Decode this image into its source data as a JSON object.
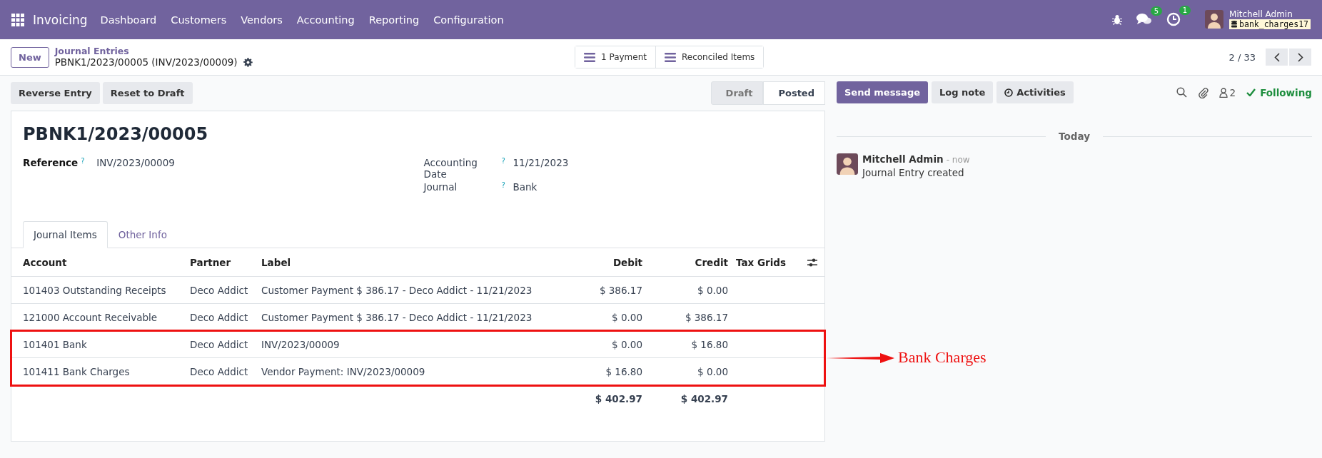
{
  "navbar": {
    "app": "Invoicing",
    "menu": [
      "Dashboard",
      "Customers",
      "Vendors",
      "Accounting",
      "Reporting",
      "Configuration"
    ],
    "messages_badge": "5",
    "activities_badge": "1",
    "user": "Mitchell Admin",
    "database": "bank_charges17"
  },
  "breadcrumb": {
    "new_button": "New",
    "parent": "Journal Entries",
    "current": "PBNK1/2023/00005 (INV/2023/00009)"
  },
  "smart_buttons": [
    "1 Payment",
    "Reconciled Items"
  ],
  "pager": {
    "value": "2 / 33"
  },
  "actions": [
    "Reverse Entry",
    "Reset to Draft"
  ],
  "statuses": [
    {
      "label": "Draft",
      "selected": false
    },
    {
      "label": "Posted",
      "selected": true
    }
  ],
  "form": {
    "title": "PBNK1/2023/00005",
    "fields_left": [
      {
        "label": "Reference",
        "help": "?",
        "value": "INV/2023/00009"
      }
    ],
    "fields_right": [
      {
        "label": "Accounting Date",
        "help": "?",
        "value": "11/21/2023"
      },
      {
        "label": "Journal",
        "help": "?",
        "value": "Bank"
      }
    ],
    "tabs": [
      {
        "label": "Journal Items",
        "selected": true
      },
      {
        "label": "Other Info",
        "selected": false
      }
    ],
    "table": {
      "columns": [
        {
          "label": "Account",
          "kind": "text"
        },
        {
          "label": "Partner",
          "kind": "text"
        },
        {
          "label": "Label",
          "kind": "text"
        },
        {
          "label": "Debit",
          "kind": "amount"
        },
        {
          "label": "Credit",
          "kind": "amount"
        },
        {
          "label": "Tax Grids",
          "kind": "text"
        }
      ],
      "rows": [
        {
          "cells": [
            "101403 Outstanding Receipts",
            "Deco Addict",
            "Customer Payment $ 386.17 - Deco Addict - 11/21/2023",
            "$ 386.17",
            "$ 0.00"
          ],
          "in_callout": false
        },
        {
          "cells": [
            "121000 Account Receivable",
            "Deco Addict",
            "Customer Payment $ 386.17 - Deco Addict - 11/21/2023",
            "$ 0.00",
            "$ 386.17"
          ],
          "in_callout": false
        },
        {
          "cells": [
            "101401 Bank",
            "Deco Addict",
            "INV/2023/00009",
            "$ 0.00",
            "$ 16.80"
          ],
          "in_callout": true
        },
        {
          "cells": [
            "101411 Bank Charges",
            "Deco Addict",
            "Vendor Payment: INV/2023/00009",
            "$ 16.80",
            "$ 0.00"
          ],
          "in_callout": true
        }
      ],
      "totals": {
        "debit": "$ 402.97",
        "credit": "$ 402.97"
      }
    }
  },
  "callout": {
    "label": "Bank Charges"
  },
  "chatter": {
    "buttons": [
      {
        "label": "Send message",
        "kind": "primary"
      },
      {
        "label": "Log note",
        "kind": "secondary"
      },
      {
        "label": "Activities",
        "kind": "activities"
      }
    ],
    "followers": "2",
    "following": "Following",
    "date_separator": "Today",
    "messages": [
      {
        "author": "Mitchell Admin",
        "time": "- now",
        "body": "Journal Entry created"
      }
    ]
  }
}
